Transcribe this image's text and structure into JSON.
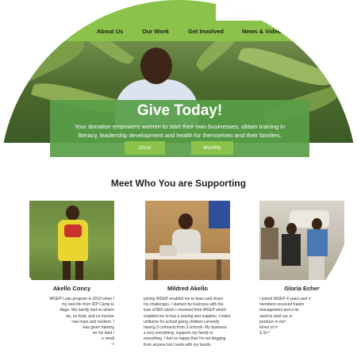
{
  "nav": {
    "items": [
      {
        "label": "About Us"
      },
      {
        "label": "Our Work"
      },
      {
        "label": "Get Involved"
      },
      {
        "label": "News & Video"
      }
    ],
    "bg_color": "#8bc34a"
  },
  "hero": {
    "title": "Give Today!",
    "text_line1": "Your donation empowers women to start their own businesses, obtain training in",
    "text_line2": "literacy, leadership development and health for themselves and their families.",
    "buttons": [
      {
        "label": "Once"
      },
      {
        "label": "Monthly"
      }
    ],
    "overlay_color": "#589e48"
  },
  "section": {
    "title": "Meet Who You are Supporting"
  },
  "people": [
    {
      "name": "Akello Concy",
      "bio": [
        "WGEP Loan program in 2010 when I",
        "my new life from IDP Camp to",
        "illage. We hardly had no where",
        "ter, no food, and no income",
        "was hope and resilient. I",
        "was given training",
        "en my land I",
        "e small",
        "ind"
      ]
    },
    {
      "name": "Mildred Akello",
      "bio": [
        "joining WGEP enabled me to learn and share",
        "my challenges. I started my business with the",
        "loan of $65 which I received from WGEP which",
        "enabled me to buy a sewing and supplies. I make",
        "uniforms for school going children currently",
        "having 3 contracts from 3 schools. My business",
        "s very everything, supports my family in",
        "everything. I feel so happy that I'm not begging",
        "from anyone but I work with my hands."
      ]
    },
    {
      "name": "Gloria Echer",
      "bio": [
        "I joined WGEP 4 years and m",
        "members received trainin",
        "management and a loi",
        "used to start our ae",
        "produce in major",
        "tones of goo",
        "S.Sudan",
        "ng"
      ]
    }
  ]
}
